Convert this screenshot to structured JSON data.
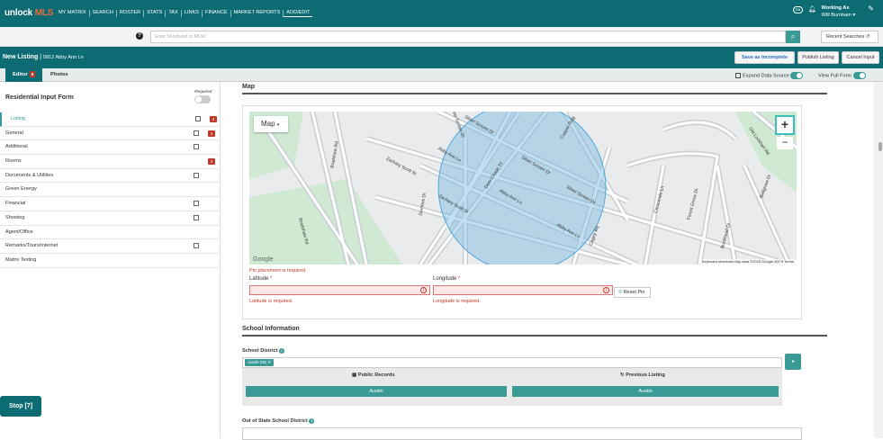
{
  "brand": {
    "logo_a": "unlock",
    "logo_b": "MLS"
  },
  "nav": {
    "items": [
      "MY MATRIX",
      "SEARCH",
      "ROSTER",
      "STATS",
      "TAX",
      "LINKS",
      "FINANCE",
      "MARKET REPORTS",
      "ADD/EDIT"
    ],
    "active": "ADD/EDIT"
  },
  "account": {
    "aa": "Aa",
    "working_as": "Working As",
    "user": "Will Burnham ▾"
  },
  "search": {
    "placeholder": "Enter Shorthand or MLS#",
    "recent": "Recent Searches"
  },
  "listing": {
    "title": "New Listing",
    "address": "5812 Abby Ann Ln",
    "save": "Save as Incomplete",
    "publish": "Publish Listing",
    "cancel": "Cancel Input"
  },
  "tabs": {
    "editor": "Editor",
    "editor_badge": "8",
    "photos": "Photos",
    "expand": "Expand Data Source",
    "view_full": "View Full Form"
  },
  "sidebar": {
    "title": "Residential Input Form",
    "required": "Required",
    "items": [
      {
        "label": "Listing",
        "icon": true,
        "badge": "4"
      },
      {
        "label": "General",
        "icon": true,
        "badge": "2"
      },
      {
        "label": "Additional",
        "icon": true,
        "badge": ""
      },
      {
        "label": "Rooms",
        "icon": false,
        "badge": "2"
      },
      {
        "label": "Documents & Utilities",
        "icon": true,
        "badge": ""
      },
      {
        "label": "Green Energy",
        "icon": false,
        "badge": ""
      },
      {
        "label": "Financial",
        "icon": true,
        "badge": ""
      },
      {
        "label": "Showing",
        "icon": true,
        "badge": ""
      },
      {
        "label": "Agent/Office",
        "icon": false,
        "badge": ""
      },
      {
        "label": "Remarks/Tours/Internet",
        "icon": true,
        "badge": ""
      },
      {
        "label": "Matrix Testing",
        "icon": false,
        "badge": ""
      }
    ],
    "stop": "Stop [7]"
  },
  "map_section": {
    "title": "Map",
    "map_type": "Map",
    "pin_error": "Pin placement is required.",
    "lat_label": "Latitude",
    "lat_error": "Latitude is required.",
    "lng_label": "Longitude",
    "lng_error": "Longitude is required.",
    "reset_pin": "Reset Pin",
    "footer": "Keyboard shortcuts    Map data ©2025 Google    200 ft         Terms",
    "google": "Google",
    "streets": [
      "Silver Screen Dr",
      "Abby Ann Ln",
      "Zachary Scott St",
      "Deer Chase Trl",
      "Cagey Wy",
      "Bradshaw Rd",
      "Old Lockhart Rd",
      "Crescendo Ln",
      "Forest Grove Dr",
      "Bunkhead Dr",
      "Bellgrove Dr",
      "Zachary Scott St",
      "Dornbus Dr",
      "Copper Ridg"
    ]
  },
  "school": {
    "title": "School Information",
    "district_label": "School District",
    "chip": "Austin ISD",
    "public_records": "Public Records",
    "previous_listing": "Previous Listing",
    "btn_left": "Austin",
    "btn_right": "Austin",
    "out_of_state": "Out of State School District"
  },
  "colors": {
    "teal": "#0d6b74",
    "accent": "#3a9b96",
    "error": "#c0392b"
  }
}
